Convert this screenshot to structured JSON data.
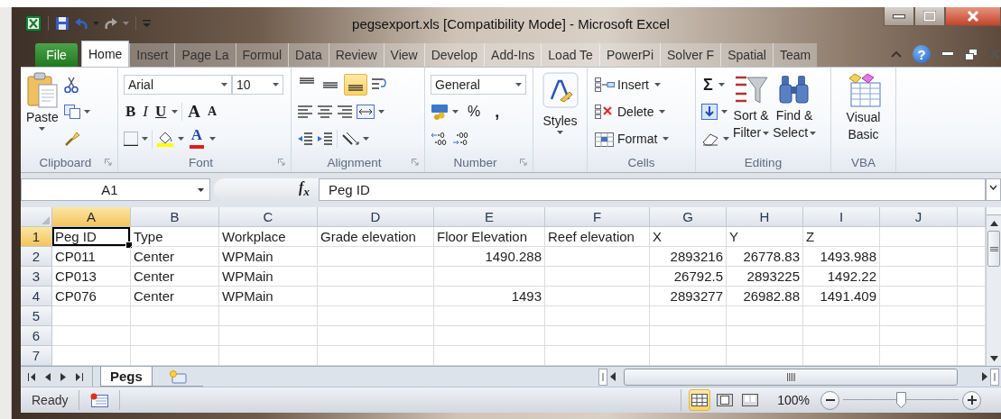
{
  "window": {
    "title": "pegsexport.xls  [Compatibility Mode]  -  Microsoft Excel"
  },
  "ribbon_tabs": [
    {
      "label": "File",
      "kind": "file",
      "selected": false
    },
    {
      "label": "Home",
      "kind": "tab",
      "selected": true
    },
    {
      "label": "Insert",
      "kind": "tab",
      "selected": false
    },
    {
      "label": "Page La",
      "kind": "tab",
      "selected": false
    },
    {
      "label": "Formul",
      "kind": "tab",
      "selected": false
    },
    {
      "label": "Data",
      "kind": "tab",
      "selected": false
    },
    {
      "label": "Review",
      "kind": "tab",
      "selected": false
    },
    {
      "label": "View",
      "kind": "tab",
      "selected": false
    },
    {
      "label": "Develop",
      "kind": "tab",
      "selected": false
    },
    {
      "label": "Add-Ins",
      "kind": "tab",
      "selected": false
    },
    {
      "label": "Load Te",
      "kind": "tab",
      "selected": false
    },
    {
      "label": "PowerPi",
      "kind": "tab",
      "selected": false
    },
    {
      "label": "Solver F",
      "kind": "tab",
      "selected": false
    },
    {
      "label": "Spatial",
      "kind": "tab",
      "selected": false
    },
    {
      "label": "Team",
      "kind": "tab",
      "selected": false
    }
  ],
  "help": "?",
  "ribbon": {
    "clipboard": {
      "label": "Clipboard",
      "paste": "Paste"
    },
    "font": {
      "label": "Font",
      "font_name": "Arial",
      "font_size": "10",
      "bold": "B",
      "italic": "I",
      "underline": "U",
      "grow": "A",
      "shrink": "A",
      "font_color": "A"
    },
    "alignment": {
      "label": "Alignment",
      "vertical": [
        {
          "kind": "top",
          "selected": false
        },
        {
          "kind": "middle",
          "selected": false
        },
        {
          "kind": "bottom",
          "selected": true
        }
      ]
    },
    "number": {
      "label": "Number",
      "format": "General",
      "percent": "%",
      "comma": ","
    },
    "styles": {
      "label": "Styles"
    },
    "cells": {
      "label": "Cells",
      "buttons": [
        {
          "label": "Insert",
          "kind": "insert"
        },
        {
          "label": "Delete",
          "kind": "delete"
        },
        {
          "label": "Format",
          "kind": "format"
        }
      ]
    },
    "editing": {
      "label": "Editing",
      "autosum": "Σ",
      "sort_filter": [
        "Sort &",
        "Filter"
      ],
      "find_select": [
        "Find &",
        "Select"
      ]
    },
    "vba": {
      "label": "VBA",
      "visual_basic": [
        "Visual",
        "Basic"
      ]
    }
  },
  "formula_bar": {
    "name_box": "A1",
    "function_label": "f$_{x}$",
    "value": "Peg ID"
  },
  "sheet": {
    "columns": [
      {
        "label": "A",
        "selected": true
      },
      {
        "label": "B",
        "selected": false
      },
      {
        "label": "C",
        "selected": false
      },
      {
        "label": "D",
        "selected": false
      },
      {
        "label": "E",
        "selected": false
      },
      {
        "label": "F",
        "selected": false
      },
      {
        "label": "G",
        "selected": false
      },
      {
        "label": "H",
        "selected": false
      },
      {
        "label": "I",
        "selected": false
      },
      {
        "label": "J",
        "selected": false
      }
    ],
    "rows": [
      {
        "header": "1",
        "selected": true,
        "cells": [
          {
            "text": "Peg ID",
            "kind": "text",
            "selected": true
          },
          {
            "text": "Type",
            "kind": "text",
            "selected": false
          },
          {
            "text": "Workplace",
            "kind": "text",
            "selected": false
          },
          {
            "text": "Grade elevation",
            "kind": "text",
            "selected": false
          },
          {
            "text": "Floor Elevation",
            "kind": "text",
            "selected": false
          },
          {
            "text": "Reef elevation",
            "kind": "text",
            "selected": false
          },
          {
            "text": "X",
            "kind": "text",
            "selected": false
          },
          {
            "text": "Y",
            "kind": "text",
            "selected": false
          },
          {
            "text": "Z",
            "kind": "text",
            "selected": false
          },
          {
            "selected": false
          }
        ]
      },
      {
        "header": "2",
        "selected": false,
        "cells": [
          {
            "text": "CP011",
            "kind": "text",
            "selected": false
          },
          {
            "text": "Center",
            "kind": "text",
            "selected": false
          },
          {
            "text": "WPMain",
            "kind": "text",
            "selected": false
          },
          {
            "selected": false
          },
          {
            "text": "1490.288",
            "kind": "number",
            "selected": false
          },
          {
            "selected": false
          },
          {
            "text": "2893216",
            "kind": "number",
            "selected": false
          },
          {
            "text": "26778.83",
            "kind": "number",
            "selected": false
          },
          {
            "text": "1493.988",
            "kind": "number",
            "selected": false
          },
          {
            "selected": false
          }
        ]
      },
      {
        "header": "3",
        "selected": false,
        "cells": [
          {
            "text": "CP013",
            "kind": "text",
            "selected": false
          },
          {
            "text": "Center",
            "kind": "text",
            "selected": false
          },
          {
            "text": "WPMain",
            "kind": "text",
            "selected": false
          },
          {
            "selected": false
          },
          {
            "selected": false
          },
          {
            "selected": false
          },
          {
            "text": "26792.5",
            "kind": "number",
            "selected": false
          },
          {
            "text": "2893225",
            "kind": "number",
            "selected": false
          },
          {
            "text": "1492.22",
            "kind": "number",
            "selected": false
          },
          {
            "selected": false
          }
        ]
      },
      {
        "header": "4",
        "selected": false,
        "cells": [
          {
            "text": "CP076",
            "kind": "text",
            "selected": false
          },
          {
            "text": "Center",
            "kind": "text",
            "selected": false
          },
          {
            "text": "WPMain",
            "kind": "text",
            "selected": false
          },
          {
            "selected": false
          },
          {
            "text": "1493",
            "kind": "number",
            "selected": false
          },
          {
            "selected": false
          },
          {
            "text": "2893277",
            "kind": "number",
            "selected": false
          },
          {
            "text": "26982.88",
            "kind": "number",
            "selected": false
          },
          {
            "text": "1491.409",
            "kind": "number",
            "selected": false
          },
          {
            "selected": false
          }
        ]
      },
      {
        "header": "5",
        "selected": false
      },
      {
        "header": "6",
        "selected": false
      },
      {
        "header": "7",
        "selected": false
      }
    ]
  },
  "sheet_tabs": [
    {
      "label": "Pegs",
      "selected": true
    }
  ],
  "status_bar": {
    "status": "Ready",
    "views": [
      {
        "kind": "normal",
        "selected": true
      },
      {
        "kind": "page_layout",
        "selected": false
      },
      {
        "kind": "page_break",
        "selected": false
      }
    ],
    "zoom": "100%",
    "zoom_slider": {
      "level": 0.5
    }
  }
}
